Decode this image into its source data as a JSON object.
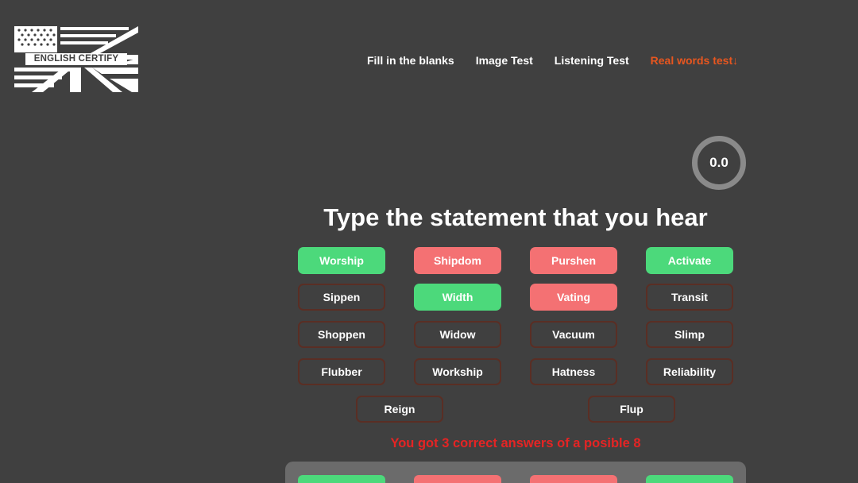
{
  "logo": {
    "text": "ENGLISH CERTIFY"
  },
  "nav": {
    "links": [
      {
        "label": "Fill in the blanks",
        "active": false
      },
      {
        "label": "Image Test",
        "active": false
      },
      {
        "label": "Listening Test",
        "active": false
      },
      {
        "label": "Real words test↓",
        "active": true
      }
    ]
  },
  "score": {
    "value": "0.0"
  },
  "heading": "Type the statement that you hear",
  "words": [
    {
      "label": "Worship",
      "state": "correct"
    },
    {
      "label": "Shipdom",
      "state": "wrong"
    },
    {
      "label": "Purshen",
      "state": "wrong"
    },
    {
      "label": "Activate",
      "state": "correct"
    },
    {
      "label": "Sippen",
      "state": "neutral"
    },
    {
      "label": "Width",
      "state": "correct"
    },
    {
      "label": "Vating",
      "state": "wrong"
    },
    {
      "label": "Transit",
      "state": "neutral"
    },
    {
      "label": "Shoppen",
      "state": "neutral"
    },
    {
      "label": "Widow",
      "state": "neutral"
    },
    {
      "label": "Vacuum",
      "state": "neutral"
    },
    {
      "label": "Slimp",
      "state": "neutral"
    },
    {
      "label": "Flubber",
      "state": "neutral"
    },
    {
      "label": "Workship",
      "state": "neutral"
    },
    {
      "label": "Hatness",
      "state": "neutral"
    },
    {
      "label": "Reliability",
      "state": "neutral"
    },
    {
      "label": "Reign",
      "state": "neutral"
    },
    {
      "label": "Flup",
      "state": "neutral"
    }
  ],
  "result": "You got 3 correct answers of a posible 8",
  "colors": {
    "background": "#404040",
    "accent": "#e8561f",
    "correct": "#4cd97b",
    "wrong": "#f47173",
    "neutral_border": "#5a2e24",
    "result_text": "#e52424"
  }
}
